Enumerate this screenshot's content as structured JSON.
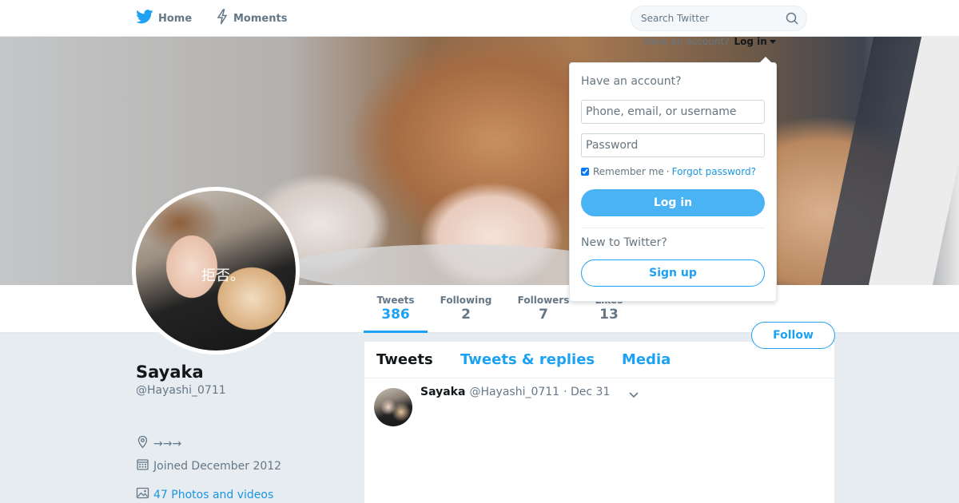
{
  "nav": {
    "home_label": "Home",
    "moments_label": "Moments",
    "search_placeholder": "Search Twitter",
    "icons": {
      "home": "twitter-bird-icon",
      "moments": "lightning-icon",
      "search": "search-icon"
    }
  },
  "login_hint": {
    "question": "Have an account?",
    "link": "Log in"
  },
  "login_dropdown": {
    "title": "Have an account?",
    "username_placeholder": "Phone, email, or username",
    "password_placeholder": "Password",
    "remember_label": "Remember me",
    "separator": "·",
    "forgot_label": "Forgot password?",
    "login_button": "Log in",
    "new_label": "New to Twitter?",
    "signup_button": "Sign up"
  },
  "profile": {
    "avatar_text": "拒否。",
    "name": "Sayaka",
    "handle": "@Hayashi_0711",
    "location": "→→→",
    "joined": "Joined December 2012",
    "photos_link": "47 Photos and videos"
  },
  "stats": [
    {
      "label": "Tweets",
      "value": "386"
    },
    {
      "label": "Following",
      "value": "2"
    },
    {
      "label": "Followers",
      "value": "7"
    },
    {
      "label": "Likes",
      "value": "13"
    }
  ],
  "follow_button": "Follow",
  "timeline": {
    "tabs": [
      {
        "label": "Tweets"
      },
      {
        "label": "Tweets & replies"
      },
      {
        "label": "Media"
      }
    ],
    "tweet": {
      "fullname": "Sayaka",
      "username": "@Hayashi_0711",
      "time": "· Dec 31"
    }
  },
  "colors": {
    "accent": "#1da1f2",
    "background": "#e6ecf0",
    "login_button_bg": "#4ab3f4"
  }
}
